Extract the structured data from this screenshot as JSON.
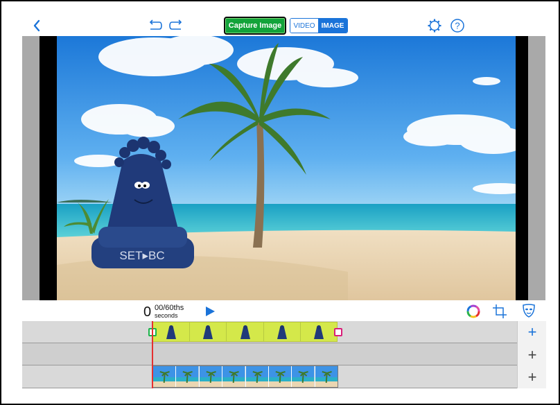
{
  "toolbar": {
    "capture_label": "Capture Image",
    "mode_video": "VIDEO",
    "mode_image": "IMAGE",
    "icons": [
      "chevron-left-icon",
      "undo-icon",
      "redo-icon",
      "gear-icon",
      "help-icon"
    ]
  },
  "stage": {
    "watermark": "SET▸BC"
  },
  "playback": {
    "time_whole": "0",
    "time_fraction": "00/60ths",
    "time_unit": "seconds",
    "icons": [
      "play-icon",
      "color-wheel-icon",
      "crop-icon",
      "mask-icon"
    ]
  },
  "timeline": {
    "tracks": [
      {
        "type": "character",
        "frames": 5
      },
      {
        "type": "empty"
      },
      {
        "type": "background",
        "frames": 8
      }
    ],
    "add_icons": [
      "plus-icon",
      "plus-icon",
      "plus-icon"
    ]
  },
  "colors": {
    "accent": "#1a73d9",
    "capture": "#12a33a",
    "clip": "#d4e84a",
    "playhead": "#e53030"
  }
}
